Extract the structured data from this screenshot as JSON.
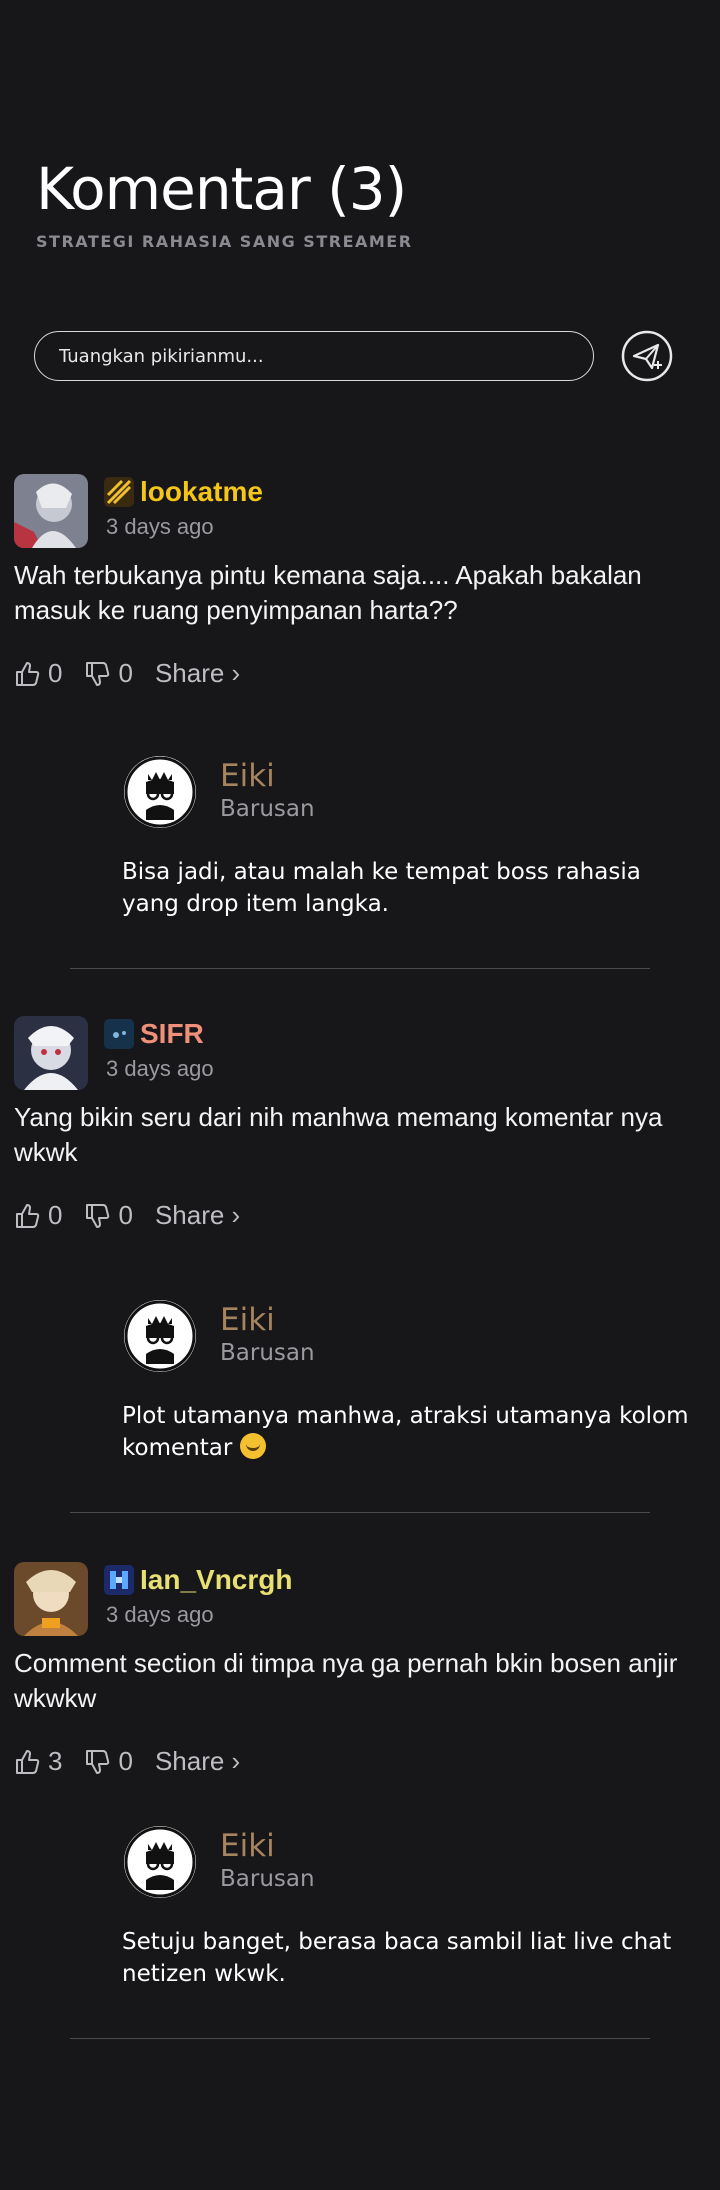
{
  "header": {
    "title": "Komentar (3)",
    "subtitle": "STRATEGI RAHASIA SANG STREAMER"
  },
  "compose": {
    "placeholder": "Tuangkan pikirianmu...",
    "send_icon": "send-plane-icon"
  },
  "comments": [
    {
      "username": "lookatme",
      "username_color": "#f5c518",
      "time": "3 days ago",
      "text": "Wah terbukanya pintu kemana saja.... Apakah bakalan masuk ke ruang penyimpanan harta??",
      "likes": "0",
      "dislikes": "0",
      "share": "Share ›",
      "reply": {
        "name": "Eiki",
        "time": "Barusan",
        "text": "Bisa jadi, atau malah ke tempat boss rahasia yang drop item langka."
      }
    },
    {
      "username": "SIFR",
      "username_color": "#f0907a",
      "time": "3 days ago",
      "text": "Yang bikin seru dari nih manhwa memang komentar nya wkwk",
      "likes": "0",
      "dislikes": "0",
      "share": "Share ›",
      "reply": {
        "name": "Eiki",
        "time": "Barusan",
        "text": "Plot utamanya manhwa, atraksi utamanya kolom komentar",
        "emoji": "rolling-on-floor-laughing"
      }
    },
    {
      "username": "Ian_Vncrgh",
      "username_color": "#e8e070",
      "time": "3 days ago",
      "text": "Comment section di timpa nya ga pernah bkin bosen anjir wkwkw",
      "likes": "3",
      "dislikes": "0",
      "share": "Share ›",
      "reply": {
        "name": "Eiki",
        "time": "Barusan",
        "text": "Setuju banget, berasa baca sambil liat live chat netizen wkwk."
      }
    }
  ]
}
